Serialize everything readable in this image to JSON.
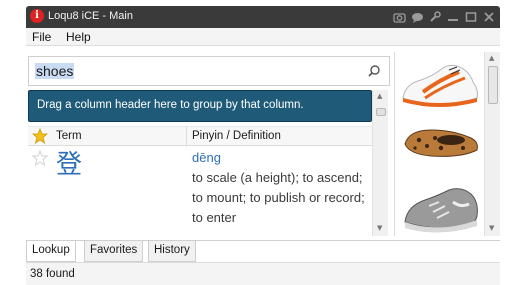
{
  "window": {
    "title": "Loqu8 iCE - Main",
    "icon_name": "app-logo-icon",
    "controls": [
      "camera-icon",
      "chat-icon",
      "wrench-icon",
      "minimize-icon",
      "maximize-icon",
      "close-icon"
    ]
  },
  "menu": {
    "items": [
      "File",
      "Help"
    ]
  },
  "search": {
    "value": "shoes"
  },
  "grid": {
    "group_hint": "Drag a column header here to group by that column.",
    "columns": {
      "term": "Term",
      "definition": "Pinyin / Definition"
    },
    "rows": [
      {
        "term": "登",
        "pinyin": "dēng",
        "definition": "to scale (a height); to ascend; to mount; to publish or record; to enter"
      }
    ]
  },
  "images": {
    "items": [
      "white sneaker with orange stripes",
      "leopard print flat shoe",
      "gray running shoe"
    ]
  },
  "tabs": {
    "items": [
      "Lookup",
      "Favorites",
      "History"
    ],
    "active": "Lookup"
  },
  "status": {
    "text": "38 found"
  },
  "colors": {
    "group_bar": "#1f5b78",
    "link_blue": "#2e6fb8",
    "selection": "#c9dbf3",
    "titlebar": "#3a3a3a"
  }
}
